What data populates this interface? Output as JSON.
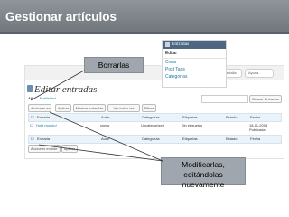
{
  "page": {
    "title": "Gestionar artículos"
  },
  "callouts": {
    "delete": "Borrarlas",
    "edit": "Modificarlas, editándolas nuevamente"
  },
  "menu": {
    "title": "Entradas",
    "items": [
      "Editar",
      "Crear",
      "Post Tags",
      "Categorías"
    ]
  },
  "screen": {
    "header_buttons": [
      "Opciones de pantalla",
      "Ayuda"
    ],
    "heading": "Editar entradas",
    "filters": [
      "All",
      "Published"
    ],
    "search_button": "Buscar Entradas",
    "toolbar": {
      "bulk_select": "Acciones en lote",
      "apply": "Aplicar",
      "date_select": "Mostrar todas las fe",
      "cat_select": "Ver todas las categ",
      "filter": "Filtrar"
    },
    "columns": [
      "Entrada",
      "Autor",
      "Categorías",
      "Etiquetas",
      "Estado",
      "Fecha"
    ],
    "row": {
      "title": "Hola mundo!",
      "author": "cionw",
      "category": "Uncategorized",
      "tags": "Sin etiquetas",
      "date": "18-11-2008",
      "status": "Publicada"
    },
    "bottom_select": "Acciones en lote",
    "bottom_apply": "Aplicar"
  },
  "colors": {
    "title_bar": "#7f868c",
    "callout": "#9fa6ad",
    "menu_header": "#4d6783"
  }
}
